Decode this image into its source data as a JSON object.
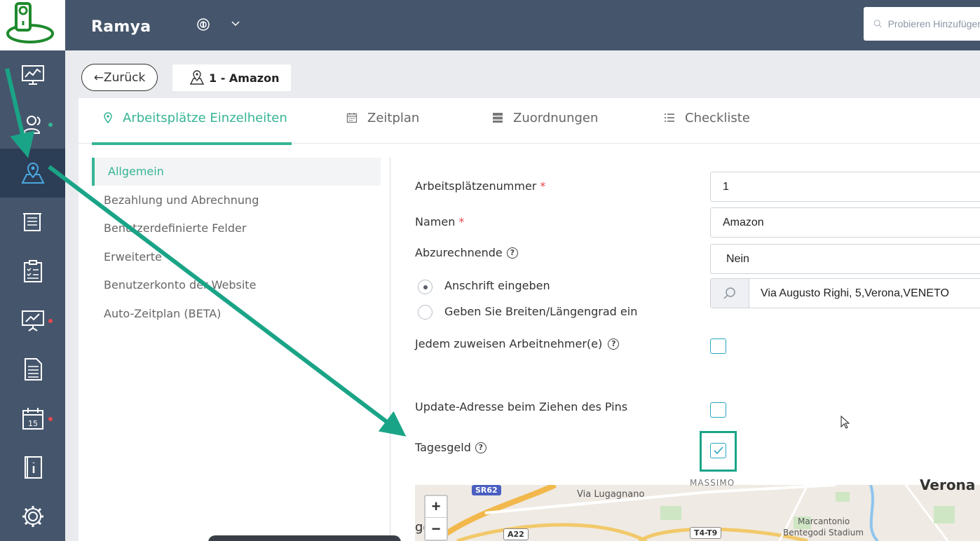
{
  "header": {
    "company_name": "Ramya",
    "search_placeholder": "Probieren Hinzufügen"
  },
  "sidebar": {
    "items": [
      {
        "icon": "dashboard-icon"
      },
      {
        "icon": "users-icon",
        "dot": "#36b595"
      },
      {
        "icon": "map-location-icon",
        "active": true
      },
      {
        "icon": "timesheet-icon"
      },
      {
        "icon": "checklist-icon"
      },
      {
        "icon": "reports-icon",
        "dot": "#e5484d"
      },
      {
        "icon": "document-icon"
      },
      {
        "icon": "calendar-icon",
        "calendar_day": "15",
        "dot": "#e5484d"
      },
      {
        "icon": "manual-icon"
      },
      {
        "icon": "settings-icon"
      }
    ]
  },
  "toolbar": {
    "back_label": "←Zurück",
    "workplace_title": "1 - Amazon"
  },
  "tabs": [
    {
      "label": "Arbeitsplätze Einzelheiten",
      "active": true
    },
    {
      "label": "Zeitplan"
    },
    {
      "label": "Zuordnungen"
    },
    {
      "label": "Checkliste"
    }
  ],
  "left_nav": [
    {
      "label": "Allgemein",
      "active": true
    },
    {
      "label": "Bezahlung und Abrechnung"
    },
    {
      "label": "Benutzerdefinierte Felder"
    },
    {
      "label": "Erweiterte"
    },
    {
      "label": "Benutzerkonto der Website"
    },
    {
      "label": "Auto-Zeitplan (BETA)"
    }
  ],
  "form": {
    "number_label": "Arbeitsplätzenummer",
    "number_value": "1",
    "name_label": "Namen",
    "name_value": "Amazon",
    "billable_label": "Abzurechnende",
    "billable_value": "Nein",
    "radio_address_label": "Anschrift eingeben",
    "radio_latlng_label": "Geben Sie Breiten/Längengrad ein",
    "address_value": "Via Augusto Righi, 5,Verona,VENETO",
    "assign_each_label": "Jedem zuweisen Arbeitnehmer(e)",
    "update_address_label": "Update-Adresse beim Ziehen des Pins",
    "per_diem_label": "Tagesgeld",
    "required_mark": "*",
    "help_mark": "?",
    "per_diem_checked": true,
    "assign_each_checked": false,
    "update_address_checked": false,
    "radio_selected": "address"
  },
  "map": {
    "zoom_in": "+",
    "zoom_out": "−",
    "labels": {
      "street": "Via Lugagnano",
      "area": "MASSIMO",
      "city": "Verona",
      "stadium_1": "Marcantonio",
      "stadium_2": "Bentegodi Stadium",
      "partial": "go"
    },
    "badges": {
      "sr62": "SR62",
      "a22": "A22",
      "t4t9": "T4-T9"
    }
  },
  "colors": {
    "accent": "#36b595",
    "sidebar": "#45566c",
    "sidebar_active": "#2c3d56",
    "annotation_arrow": "#1aa487"
  }
}
